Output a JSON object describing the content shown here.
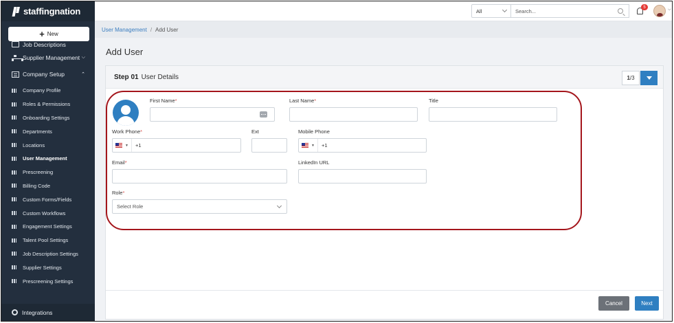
{
  "app": {
    "brand": "staffingnation"
  },
  "sidebar": {
    "new_label": "New",
    "top_items": [
      {
        "label": "Job Descriptions"
      },
      {
        "label": "Supplier Management"
      },
      {
        "label": "Company Setup"
      }
    ],
    "company_setup_items": [
      {
        "label": "Company Profile"
      },
      {
        "label": "Roles & Permissions"
      },
      {
        "label": "Onboarding Settings"
      },
      {
        "label": "Departments"
      },
      {
        "label": "Locations"
      },
      {
        "label": "User Management"
      },
      {
        "label": "Prescreening"
      },
      {
        "label": "Billing Code"
      },
      {
        "label": "Custom Forms/Fields"
      },
      {
        "label": "Custom Workflows"
      },
      {
        "label": "Engagement Settings"
      },
      {
        "label": "Talent Pool Settings"
      },
      {
        "label": "Job Description Settings"
      },
      {
        "label": "Supplier Settings"
      },
      {
        "label": "Prescreening Settings"
      }
    ],
    "active_item": "User Management",
    "bottom_item": "Integrations"
  },
  "topbar": {
    "scope_value": "All",
    "search_placeholder": "Search...",
    "notification_count": "5"
  },
  "breadcrumb": {
    "parent": "User Management",
    "separator": "/",
    "current": "Add User"
  },
  "page": {
    "title": "Add User"
  },
  "step": {
    "number": "Step 01",
    "title": "User Details",
    "current": "1",
    "total": "/3"
  },
  "form": {
    "first_name_label": "First Name",
    "last_name_label": "Last Name",
    "title_label": "Title",
    "work_phone_label": "Work Phone",
    "ext_label": "Ext",
    "mobile_phone_label": "Mobile Phone",
    "email_label": "Email",
    "linkedin_label": "LinkedIn URL",
    "role_label": "Role",
    "required_mark": "*",
    "dial_code": "+1",
    "role_placeholder": "Select Role"
  },
  "footer": {
    "cancel_label": "Cancel",
    "next_label": "Next"
  },
  "colors": {
    "primary": "#2f7fc1",
    "sidebar": "#232f3e",
    "highlight": "#a4151b",
    "required": "#d9534f"
  }
}
